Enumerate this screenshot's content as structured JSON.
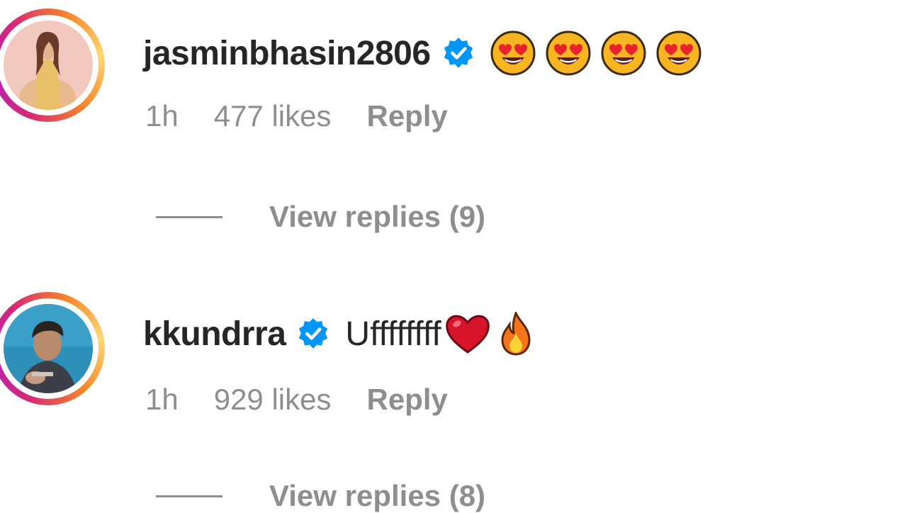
{
  "comments": [
    {
      "username": "jasminbhasin2806",
      "verified_icon": "verified-badge-icon",
      "text": "",
      "emojis": [
        "heart-eyes-emoji",
        "heart-eyes-emoji",
        "heart-eyes-emoji",
        "heart-eyes-emoji"
      ],
      "time": "1h",
      "likes": "477 likes",
      "reply_label": "Reply",
      "view_replies": "View replies (9)"
    },
    {
      "username": "kkundrra",
      "verified_icon": "verified-badge-icon",
      "text": "Uffffffff",
      "emojis": [
        "red-heart-emoji",
        "fire-emoji"
      ],
      "time": "1h",
      "likes": "929 likes",
      "reply_label": "Reply",
      "view_replies": "View replies (8)"
    }
  ],
  "colors": {
    "text": "#262626",
    "secondary": "#8e8e8e",
    "verified_blue": "#0095f6",
    "story_ring_start": "#d62976",
    "story_ring_end": "#feda75"
  }
}
